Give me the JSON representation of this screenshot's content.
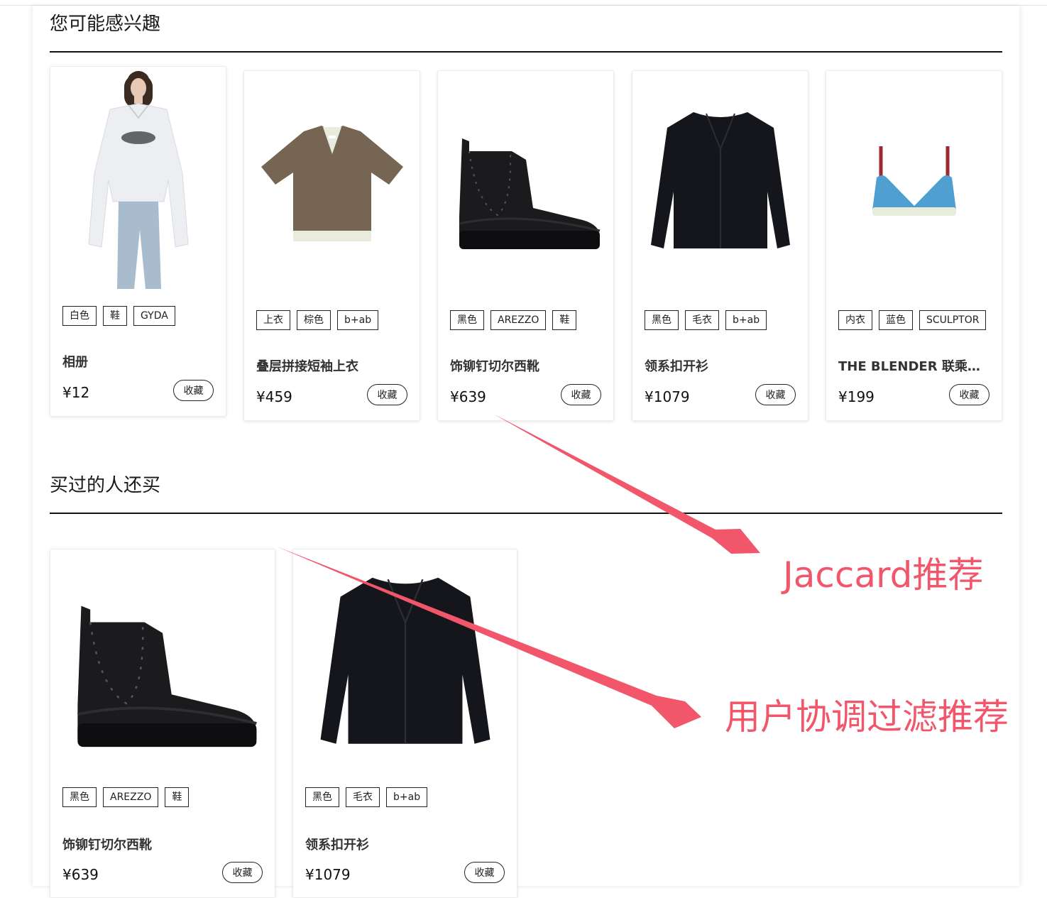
{
  "sections": [
    {
      "title": "您可能感兴趣",
      "products": [
        {
          "image": "shirt-model-image",
          "tags": [
            "白色",
            "鞋",
            "GYDA"
          ],
          "name": "相册",
          "price": "¥12",
          "fav_label": "收藏"
        },
        {
          "image": "tshirt-image",
          "tags": [
            "上衣",
            "棕色",
            "b+ab"
          ],
          "name": "叠层拼接短袖上衣",
          "price": "¥459",
          "fav_label": "收藏"
        },
        {
          "image": "boot-image",
          "tags": [
            "黑色",
            "AREZZO",
            "鞋"
          ],
          "name": "饰铆钉切尔西靴",
          "price": "¥639",
          "fav_label": "收藏"
        },
        {
          "image": "cardigan-image",
          "tags": [
            "黑色",
            "毛衣",
            "b+ab"
          ],
          "name": "领系扣开衫",
          "price": "¥1079",
          "fav_label": "收藏"
        },
        {
          "image": "bra-image",
          "tags": [
            "内衣",
            "蓝色",
            "SCULPTOR"
          ],
          "name": "THE BLENDER 联乘系列",
          "price": "¥199",
          "fav_label": "收藏"
        }
      ]
    },
    {
      "title": "买过的人还买",
      "products": [
        {
          "image": "boot-image",
          "tags": [
            "黑色",
            "AREZZO",
            "鞋"
          ],
          "name": "饰铆钉切尔西靴",
          "price": "¥639",
          "fav_label": "收藏"
        },
        {
          "image": "cardigan-image",
          "tags": [
            "黑色",
            "毛衣",
            "b+ab"
          ],
          "name": "领系扣开衫",
          "price": "¥1079",
          "fav_label": "收藏"
        }
      ]
    }
  ],
  "annotations": {
    "jaccard": "Jaccard推荐",
    "user_cf": "用户协调过滤推荐"
  },
  "colors": {
    "annotation": "#f2566b",
    "rule": "#111111"
  }
}
